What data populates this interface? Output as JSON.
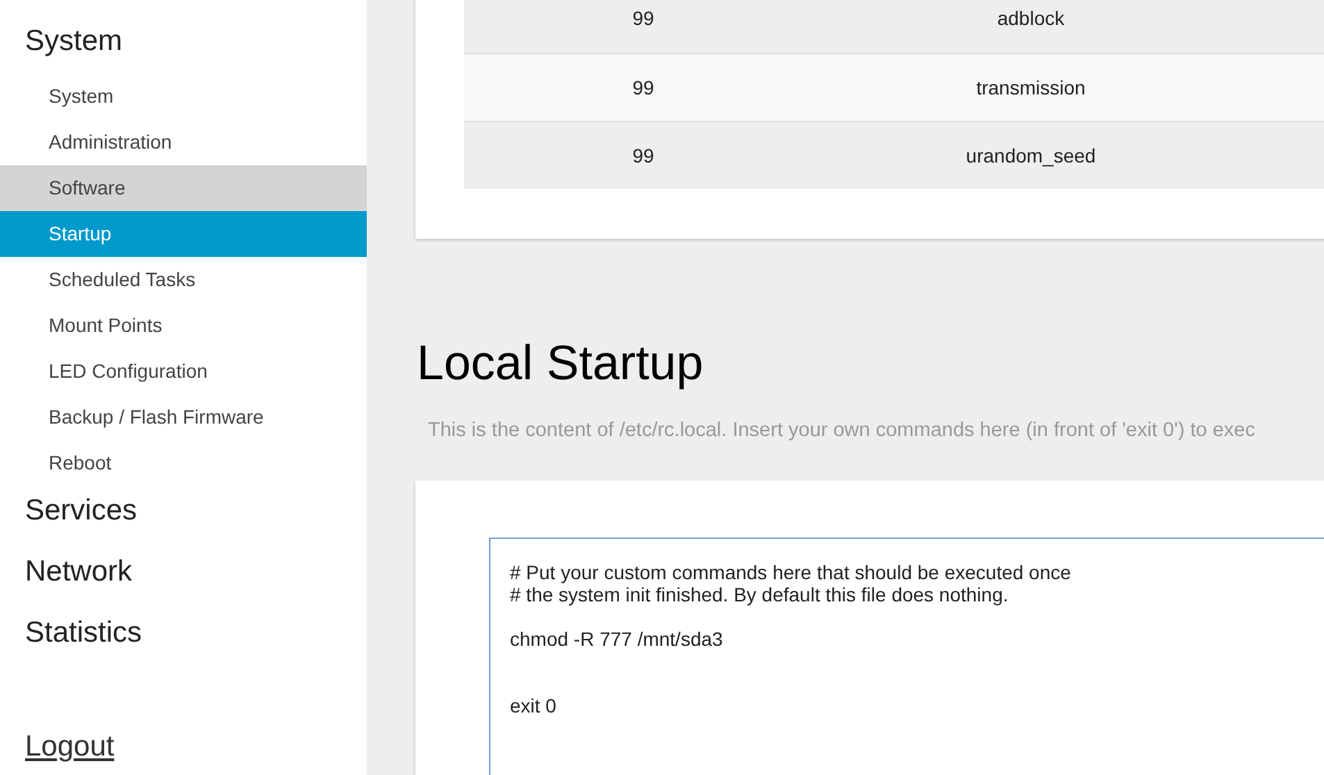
{
  "sidebar": {
    "groups": [
      {
        "title": "System",
        "items": [
          {
            "label": "System",
            "selected": false,
            "hovered": false
          },
          {
            "label": "Administration",
            "selected": false,
            "hovered": false
          },
          {
            "label": "Software",
            "selected": false,
            "hovered": true
          },
          {
            "label": "Startup",
            "selected": true,
            "hovered": false
          },
          {
            "label": "Scheduled Tasks",
            "selected": false,
            "hovered": false
          },
          {
            "label": "Mount Points",
            "selected": false,
            "hovered": false
          },
          {
            "label": "LED Configuration",
            "selected": false,
            "hovered": false
          },
          {
            "label": "Backup / Flash Firmware",
            "selected": false,
            "hovered": false
          },
          {
            "label": "Reboot",
            "selected": false,
            "hovered": false
          }
        ]
      },
      {
        "title": "Services"
      },
      {
        "title": "Network"
      },
      {
        "title": "Statistics"
      }
    ],
    "logout": "Logout"
  },
  "init_table": {
    "rows": [
      {
        "column_1": "99",
        "column_2": "adblock"
      },
      {
        "column_1": "99",
        "column_2": "transmission"
      },
      {
        "column_1": "99",
        "column_2": "urandom_seed"
      }
    ]
  },
  "local_startup": {
    "title": "Local Startup",
    "description": "This is the content of /etc/rc.local. Insert your own commands here (in front of 'exit 0') to exec",
    "value": "# Put your custom commands here that should be executed once\n# the system init finished. By default this file does nothing.\n\nchmod -R 777 /mnt/sda3\n\n\nexit 0"
  }
}
